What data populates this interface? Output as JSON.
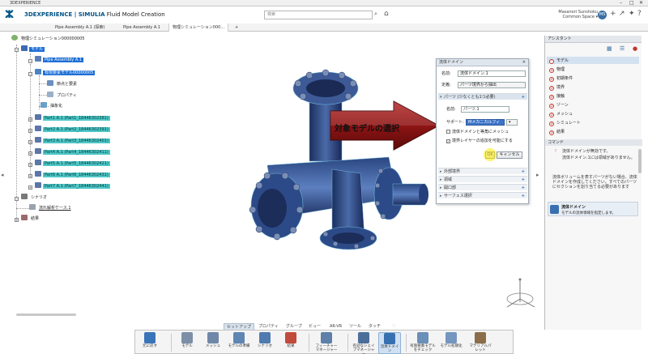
{
  "window": {
    "title": "3DEXPERIENCE",
    "controls": [
      "–",
      "□",
      "✕"
    ]
  },
  "header": {
    "brand_prefix": "3DEXPERIENCE | SIMULIA",
    "brand_suffix": "Fluid Model Creation",
    "search_placeholder": "検索",
    "user_name": "Masanori Sunshoku",
    "user_space": "Common Space ▾",
    "avatar_initials": "MS"
  },
  "tabs": [
    {
      "label": "Pipe Assembly A.1 (探索)"
    },
    {
      "label": "Pipe Assembly A.1"
    },
    {
      "label": "物理シミュレーション000..."
    },
    {
      "label": "+"
    }
  ],
  "tree": {
    "root": "物理シミュレーション000000005",
    "model": "モデル",
    "assembly": "Pipe Assembly A.1",
    "fe_model": "有限要素モデル00000005",
    "nodes_elements": "節点と要素",
    "properties": "プロパティ",
    "abstraction": "抽象化",
    "parts": [
      "Part1 A.1 (Part1_18446302381)",
      "Part2 A.1 (Part2_18446302391)",
      "Part3 A.1 (Part3_18446302401)",
      "Part4 A.1 (Part4_18446302411)",
      "Part5 A.1 (Part5_18446302421)",
      "Part6 A.1 (Part6_18446302431)",
      "Part7 A.1 (Part7_18446302441)"
    ],
    "scenario": "シナリオ",
    "flow_case": "流れ解析ケース.1",
    "results": "結果"
  },
  "callout": {
    "text": "対象モデルの選択",
    "color": "#9b1b1b"
  },
  "panel": {
    "title": "流体ドメイン",
    "name_label": "名前:",
    "name_value": "流体ドメイン.1",
    "definition_label": "定義:",
    "definition_value": "パーツ境界から抽出",
    "parts_section": "パーツ (少なくとも1つ必要)",
    "part_name_label": "名前:",
    "part_name_value": "パーツ.1",
    "support_label": "サポート:",
    "support_value": "Mメカニカルフィー",
    "checkbox1": "流体ドメインと等角にメッシュ",
    "checkbox2": "境界レイヤーの追加を可能にする",
    "ok": "OK",
    "cancel": "キャンセル",
    "sections": [
      "外部境界",
      "領域",
      "開口部",
      "サーフェス選択"
    ]
  },
  "assistant": {
    "title": "アシスタント",
    "items": [
      "モデル",
      "物理",
      "初期条件",
      "境界",
      "接触",
      "ゾーン",
      "メッシュ",
      "シミュレート",
      "結果"
    ],
    "command_title": "コマンド",
    "warning_title": "流体ドメインが無効です。",
    "warning_body": "流体ドメイン.1には領域がありません。",
    "info_text": "流体ボリュームを表すパーツがない場合、流体ドメインを作成してください。すべてのパーツにセクションを割り当てる必要があります",
    "cmd_name": "流体ドメイン",
    "cmd_desc": "モデルの流体領域を指定します。"
  },
  "section_tabs": [
    "セットアップ",
    "プロパティ",
    "グループ",
    "ビュー",
    "AR-VR",
    "ツール",
    "タッチ"
  ],
  "actions": [
    {
      "label": "元に戻す",
      "color": "#3a74b8"
    },
    {
      "label": "モデル",
      "color": "#7c8fa6"
    },
    {
      "label": "メッシュ",
      "color": "#6f88a8"
    },
    {
      "label": "モデルの準備",
      "color": "#5f86b3"
    },
    {
      "label": "シナリオ",
      "color": "#4f7bb0"
    },
    {
      "label": "結果",
      "color": "#c24a3a"
    },
    {
      "label": "フィーチャーマネージャー",
      "color": "#5d7fa8"
    },
    {
      "label": "有効なシェイプマネージャー",
      "color": "#4c6f9a"
    },
    {
      "label": "流体ドメイン",
      "color": "#3670b0"
    },
    {
      "label": "有限要素モデルをチェック",
      "color": "#6a8fb8"
    },
    {
      "label": "モデル初期化",
      "color": "#7496bf"
    },
    {
      "label": "マテリアルパレット",
      "color": "#8b6d4a"
    }
  ]
}
